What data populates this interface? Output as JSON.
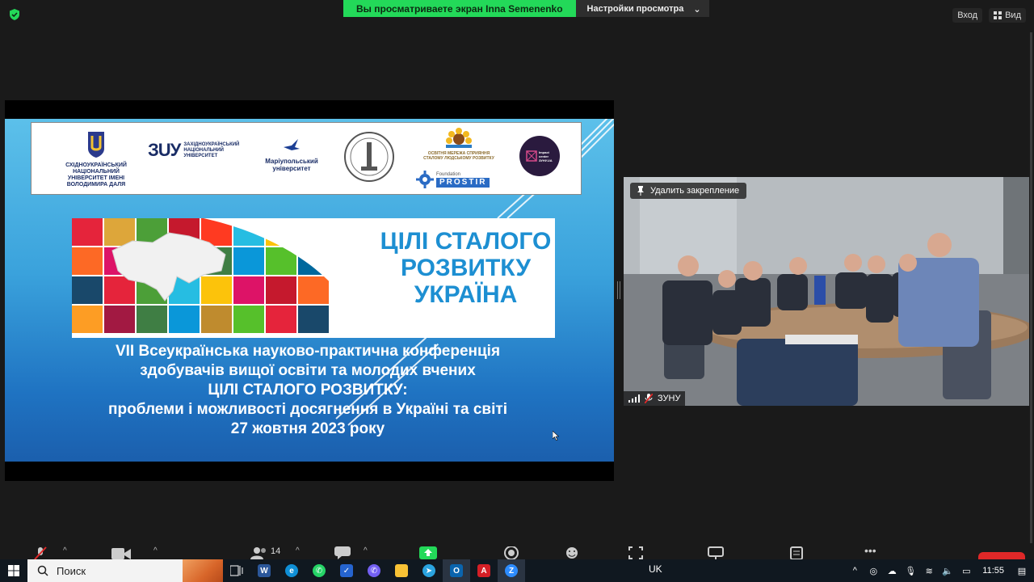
{
  "top_bar": {
    "share_prefix": "Вы просматриваете экран ",
    "share_name": "Inna Semenenko",
    "view_options_label": "Настройки просмотра",
    "login_label": "Вход",
    "view_label": "Вид"
  },
  "slide": {
    "logos": {
      "sunu": "СХІДНОУКРАЇНСЬКИЙ НАЦІОНАЛЬНИЙ УНІВЕРСИТЕТ ІМЕНІ ВОЛОДИМИРА ДАЛЯ",
      "zunu_mark": "ЗUУ",
      "zunu": "ЗАХІДНОУКРАЇНСЬКИЙ НАЦІОНАЛЬНИЙ УНІВЕРСИТЕТ",
      "mariupol": "Маріупольський університет",
      "sdg_network": "ОСВІТНЯ МЕРЕЖА СПРИЯННЯ СТАЛОМУ ЛЮДСЬКОМУ РОЗВИТКУ",
      "foundation": "Foundation",
      "prostir": "PROSTIR",
      "impact": "Impact center ЗУНУ.UA"
    },
    "sdg_title": "ЦІЛІ СТАЛОГО РОЗВИТКУ УКРАЇНА",
    "lines": [
      "VII Всеукраїнська науково-практична конференція",
      "здобувачів вищої освіти та молодих вчених",
      "ЦІЛІ СТАЛОГО РОЗВИТКУ:",
      "проблеми і можливості досягнення в Україні та світі",
      "27 жовтня 2023 року"
    ]
  },
  "video": {
    "unpin_label": "Удалить закрепление",
    "participant_name": "ЗУНУ"
  },
  "toolbar": {
    "participants_count": "14"
  },
  "taskbar": {
    "search_label": "Поиск",
    "language": "UK",
    "time": "11:55"
  },
  "colors": {
    "share_green": "#23d959",
    "slide_blue": "#3aa2dc",
    "leave_red": "#e02828"
  }
}
